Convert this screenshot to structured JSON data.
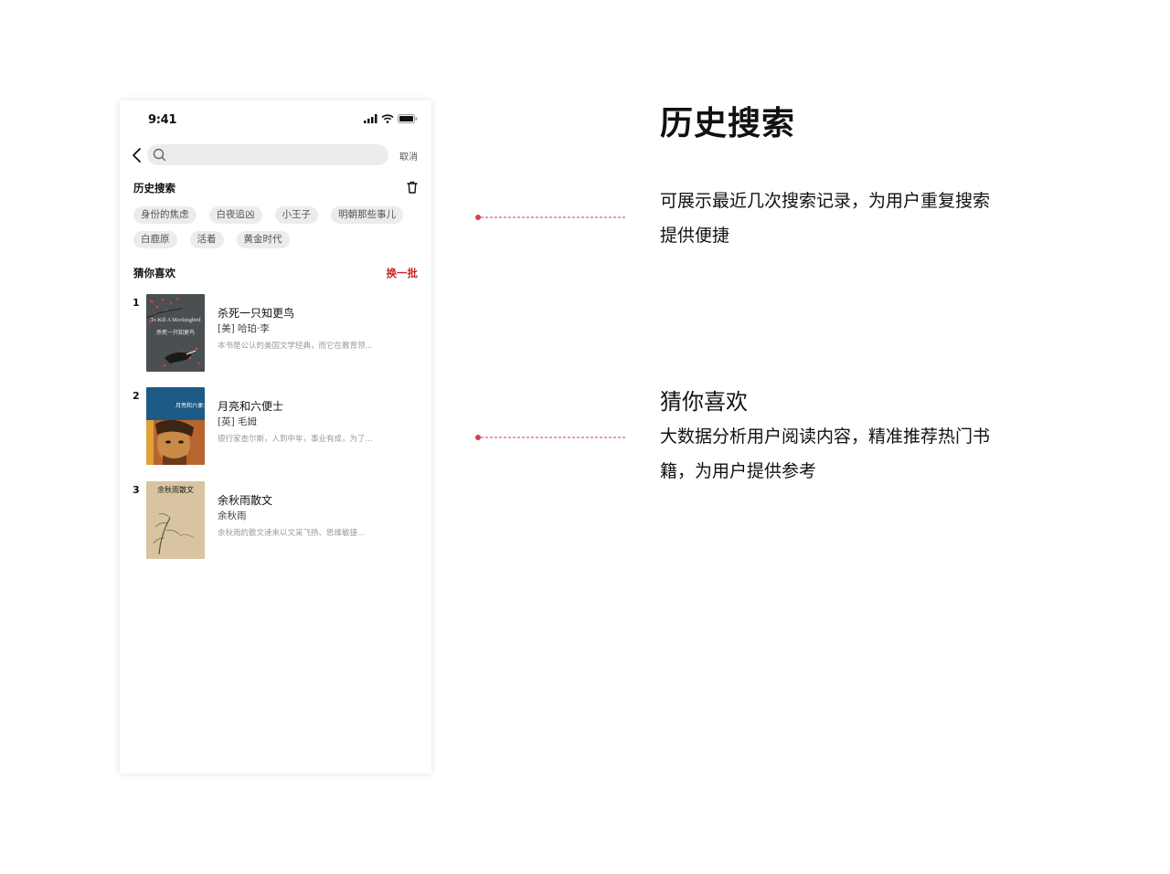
{
  "status_bar": {
    "time": "9:41"
  },
  "search": {
    "placeholder": "",
    "cancel_label": "取消"
  },
  "history": {
    "title": "历史搜索",
    "rows": [
      [
        "身份的焦虑",
        "白夜追凶",
        "小王子",
        "明朝那些事儿"
      ],
      [
        "白鹿原",
        "活着",
        "黄金时代"
      ]
    ]
  },
  "guess": {
    "title": "猜你喜欢",
    "refresh_label": "换一批",
    "books": [
      {
        "rank": "1",
        "title": "杀死一只知更鸟",
        "author": "[美] 哈珀·李",
        "desc": "本书是公认的美国文学经典，而它在教育领...",
        "cover_title_en": "To Kill A Mockingbird",
        "cover_title_cn": "杀死一只知更鸟",
        "cover_color": "#4a4f52"
      },
      {
        "rank": "2",
        "title": "月亮和六便士",
        "author": "[英] 毛姆",
        "desc": "银行家查尔斯，人到中年，事业有成，为了...",
        "cover_title_cn": "月亮和六便士",
        "cover_color": "#1e5a86"
      },
      {
        "rank": "3",
        "title": "余秋雨散文",
        "author": "余秋雨",
        "desc": "余秋雨的散文速来以文采飞扬、思维敏捷...",
        "cover_title_cn": "余秋雨散文",
        "cover_color": "#d8c4a0"
      }
    ]
  },
  "annotations": {
    "main_heading": "历史搜索",
    "history_desc_line1": "可展示最近几次搜索记录，为用户重复搜索",
    "history_desc_line2": "提供便捷",
    "guess_heading": "猜你喜欢",
    "guess_desc_line1": "大数据分析用户阅读内容，精准推荐热门书",
    "guess_desc_line2": "籍，为用户提供参考"
  },
  "colors": {
    "accent": "#c5262b",
    "tag_bg": "#ececec",
    "connector": "#d0434a"
  }
}
